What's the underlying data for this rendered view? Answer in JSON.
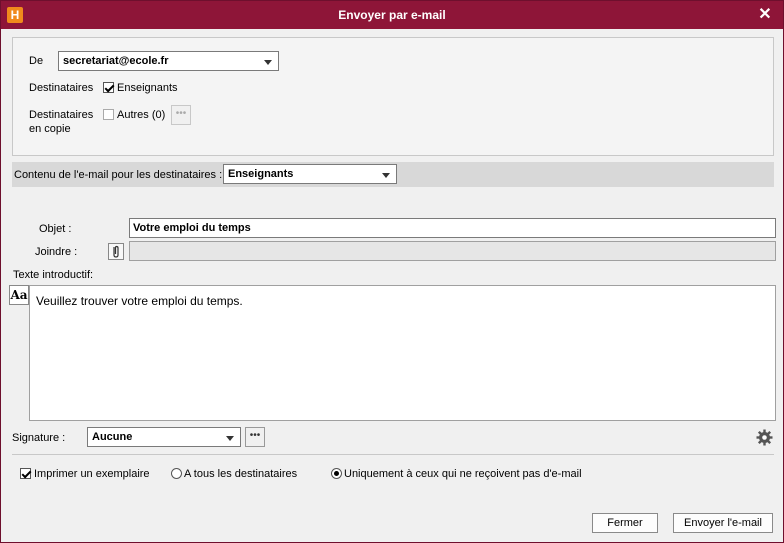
{
  "window": {
    "title": "Envoyer par e-mail",
    "app_icon_letter": "H",
    "close_glyph": "✕"
  },
  "sender": {
    "label": "De",
    "value": "secretariat@ecole.fr"
  },
  "recipients": {
    "label": "Destinataires",
    "checkbox_label": "Enseignants",
    "checked": true
  },
  "cc": {
    "label_line1": "Destinataires",
    "label_line2": "en copie",
    "checkbox_label": "Autres (0)",
    "checked": false,
    "more_glyph": "•••"
  },
  "content_for": {
    "label": "Contenu de l'e-mail pour les destinataires :",
    "value": "Enseignants"
  },
  "subject": {
    "label": "Objet :",
    "value": "Votre emploi du temps"
  },
  "attach": {
    "label": "Joindre :",
    "value": ""
  },
  "intro": {
    "label": "Texte introductif:",
    "format_glyph": "Aa",
    "text": "Veuillez trouver votre emploi du temps."
  },
  "signature": {
    "label": "Signature :",
    "value": "Aucune",
    "more_glyph": "•••"
  },
  "print_options": {
    "print_label": "Imprimer un exemplaire",
    "print_checked": true,
    "radio_all": "A tous les destinataires",
    "radio_only": "Uniquement à ceux qui ne reçoivent pas d'e-mail",
    "selected": "only"
  },
  "buttons": {
    "close": "Fermer",
    "send": "Envoyer l'e-mail"
  },
  "colors": {
    "titlebar": "#8e1538",
    "app_icon": "#f08a1c"
  }
}
